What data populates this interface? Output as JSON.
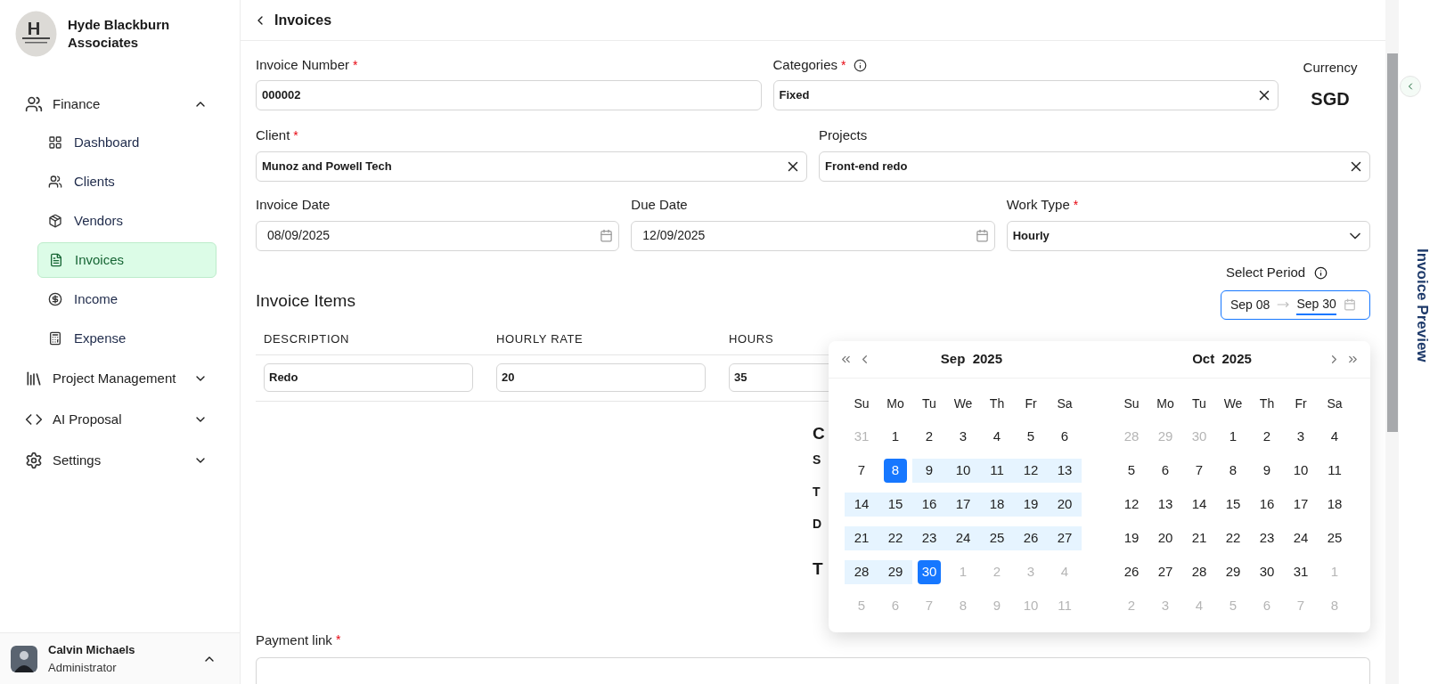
{
  "sidebar": {
    "org_name": "Hyde Blackburn Associates",
    "items": [
      {
        "label": "Finance",
        "expanded": true,
        "children": [
          {
            "label": "Dashboard",
            "selected": false
          },
          {
            "label": "Clients",
            "selected": false
          },
          {
            "label": "Vendors",
            "selected": false
          },
          {
            "label": "Invoices",
            "selected": true
          },
          {
            "label": "Income",
            "selected": false
          },
          {
            "label": "Expense",
            "selected": false
          }
        ]
      },
      {
        "label": "Project Management",
        "expanded": false
      },
      {
        "label": "AI Proposal",
        "expanded": false
      },
      {
        "label": "Settings",
        "expanded": false
      }
    ],
    "user": {
      "name": "Calvin Michaels",
      "role": "Administrator"
    }
  },
  "header": {
    "title": "Invoices"
  },
  "form": {
    "rows": [
      [
        {
          "kind": "text",
          "label": "Invoice Number",
          "required_mark": "*",
          "info": false,
          "value": "000002"
        },
        {
          "kind": "clearable",
          "label": "Categories",
          "required_mark": "*",
          "info": true,
          "value": "Fixed"
        },
        {
          "kind": "readout",
          "label": "Currency",
          "value": "SGD"
        }
      ],
      [
        {
          "kind": "clearable",
          "label": "Client",
          "required_mark": "*",
          "info": false,
          "value": "Munoz and Powell Tech"
        },
        {
          "kind": "clearable",
          "label": "Projects",
          "info": false,
          "value": "Front-end redo"
        }
      ],
      [
        {
          "kind": "date",
          "label": "Invoice Date",
          "info": false,
          "value": "08/09/2025"
        },
        {
          "kind": "date",
          "label": "Due Date",
          "info": false,
          "value": "12/09/2025"
        },
        {
          "kind": "select",
          "label": "Work Type",
          "required_mark": "*",
          "info": false,
          "value": "Hourly"
        }
      ]
    ]
  },
  "period": {
    "label": "Select Period",
    "info": true,
    "start": "Sep 08",
    "end": "Sep 30"
  },
  "invoice_items": {
    "title": "Invoice Items",
    "columns": [
      "DESCRIPTION",
      "HOURLY RATE",
      "HOURS"
    ],
    "rows": [
      [
        "Redo",
        "20",
        "35"
      ]
    ]
  },
  "summary_fragments": [
    {
      "kind": "heading",
      "text": "C"
    },
    {
      "kind": "label",
      "text": "S"
    },
    {
      "kind": "label",
      "text": "T"
    },
    {
      "kind": "label",
      "text": "D"
    },
    {
      "kind": "heading",
      "text": "T"
    }
  ],
  "calendar": {
    "months": [
      {
        "month": "Sep",
        "year": "2025",
        "weekdays": [
          "Su",
          "Mo",
          "Tu",
          "We",
          "Th",
          "Fr",
          "Sa"
        ],
        "weeks": [
          [
            {
              "t": "31",
              "out": true,
              "in_range": false,
              "selected": false
            },
            {
              "t": "1",
              "out": false,
              "in_range": false,
              "selected": false
            },
            {
              "t": "2",
              "out": false,
              "in_range": false,
              "selected": false
            },
            {
              "t": "3",
              "out": false,
              "in_range": false,
              "selected": false
            },
            {
              "t": "4",
              "out": false,
              "in_range": false,
              "selected": false
            },
            {
              "t": "5",
              "out": false,
              "in_range": false,
              "selected": false
            },
            {
              "t": "6",
              "out": false,
              "in_range": false,
              "selected": false
            }
          ],
          [
            {
              "t": "7",
              "out": false,
              "in_range": false,
              "selected": false
            },
            {
              "t": "8",
              "out": false,
              "in_range": false,
              "selected": true
            },
            {
              "t": "9",
              "out": false,
              "in_range": true,
              "selected": false
            },
            {
              "t": "10",
              "out": false,
              "in_range": true,
              "selected": false
            },
            {
              "t": "11",
              "out": false,
              "in_range": true,
              "selected": false
            },
            {
              "t": "12",
              "out": false,
              "in_range": true,
              "selected": false
            },
            {
              "t": "13",
              "out": false,
              "in_range": true,
              "selected": false
            }
          ],
          [
            {
              "t": "14",
              "out": false,
              "in_range": true,
              "selected": false
            },
            {
              "t": "15",
              "out": false,
              "in_range": true,
              "selected": false
            },
            {
              "t": "16",
              "out": false,
              "in_range": true,
              "selected": false
            },
            {
              "t": "17",
              "out": false,
              "in_range": true,
              "selected": false
            },
            {
              "t": "18",
              "out": false,
              "in_range": true,
              "selected": false
            },
            {
              "t": "19",
              "out": false,
              "in_range": true,
              "selected": false
            },
            {
              "t": "20",
              "out": false,
              "in_range": true,
              "selected": false
            }
          ],
          [
            {
              "t": "21",
              "out": false,
              "in_range": true,
              "selected": false
            },
            {
              "t": "22",
              "out": false,
              "in_range": true,
              "selected": false
            },
            {
              "t": "23",
              "out": false,
              "in_range": true,
              "selected": false
            },
            {
              "t": "24",
              "out": false,
              "in_range": true,
              "selected": false
            },
            {
              "t": "25",
              "out": false,
              "in_range": true,
              "selected": false
            },
            {
              "t": "26",
              "out": false,
              "in_range": true,
              "selected": false
            },
            {
              "t": "27",
              "out": false,
              "in_range": true,
              "selected": false
            }
          ],
          [
            {
              "t": "28",
              "out": false,
              "in_range": true,
              "selected": false
            },
            {
              "t": "29",
              "out": false,
              "in_range": true,
              "selected": false
            },
            {
              "t": "30",
              "out": false,
              "in_range": false,
              "selected": true
            },
            {
              "t": "1",
              "out": true,
              "in_range": false,
              "selected": false
            },
            {
              "t": "2",
              "out": true,
              "in_range": false,
              "selected": false
            },
            {
              "t": "3",
              "out": true,
              "in_range": false,
              "selected": false
            },
            {
              "t": "4",
              "out": true,
              "in_range": false,
              "selected": false
            }
          ],
          [
            {
              "t": "5",
              "out": true,
              "in_range": false,
              "selected": false
            },
            {
              "t": "6",
              "out": true,
              "in_range": false,
              "selected": false
            },
            {
              "t": "7",
              "out": true,
              "in_range": false,
              "selected": false
            },
            {
              "t": "8",
              "out": true,
              "in_range": false,
              "selected": false
            },
            {
              "t": "9",
              "out": true,
              "in_range": false,
              "selected": false
            },
            {
              "t": "10",
              "out": true,
              "in_range": false,
              "selected": false
            },
            {
              "t": "11",
              "out": true,
              "in_range": false,
              "selected": false
            }
          ]
        ]
      },
      {
        "month": "Oct",
        "year": "2025",
        "weekdays": [
          "Su",
          "Mo",
          "Tu",
          "We",
          "Th",
          "Fr",
          "Sa"
        ],
        "weeks": [
          [
            {
              "t": "28",
              "out": true,
              "in_range": false,
              "selected": false
            },
            {
              "t": "29",
              "out": true,
              "in_range": false,
              "selected": false
            },
            {
              "t": "30",
              "out": true,
              "in_range": false,
              "selected": false
            },
            {
              "t": "1",
              "out": false,
              "in_range": false,
              "selected": false
            },
            {
              "t": "2",
              "out": false,
              "in_range": false,
              "selected": false
            },
            {
              "t": "3",
              "out": false,
              "in_range": false,
              "selected": false
            },
            {
              "t": "4",
              "out": false,
              "in_range": false,
              "selected": false
            }
          ],
          [
            {
              "t": "5",
              "out": false,
              "in_range": false,
              "selected": false
            },
            {
              "t": "6",
              "out": false,
              "in_range": false,
              "selected": false
            },
            {
              "t": "7",
              "out": false,
              "in_range": false,
              "selected": false
            },
            {
              "t": "8",
              "out": false,
              "in_range": false,
              "selected": false
            },
            {
              "t": "9",
              "out": false,
              "in_range": false,
              "selected": false
            },
            {
              "t": "10",
              "out": false,
              "in_range": false,
              "selected": false
            },
            {
              "t": "11",
              "out": false,
              "in_range": false,
              "selected": false
            }
          ],
          [
            {
              "t": "12",
              "out": false,
              "in_range": false,
              "selected": false
            },
            {
              "t": "13",
              "out": false,
              "in_range": false,
              "selected": false
            },
            {
              "t": "14",
              "out": false,
              "in_range": false,
              "selected": false
            },
            {
              "t": "15",
              "out": false,
              "in_range": false,
              "selected": false
            },
            {
              "t": "16",
              "out": false,
              "in_range": false,
              "selected": false
            },
            {
              "t": "17",
              "out": false,
              "in_range": false,
              "selected": false
            },
            {
              "t": "18",
              "out": false,
              "in_range": false,
              "selected": false
            }
          ],
          [
            {
              "t": "19",
              "out": false,
              "in_range": false,
              "selected": false
            },
            {
              "t": "20",
              "out": false,
              "in_range": false,
              "selected": false
            },
            {
              "t": "21",
              "out": false,
              "in_range": false,
              "selected": false
            },
            {
              "t": "22",
              "out": false,
              "in_range": false,
              "selected": false
            },
            {
              "t": "23",
              "out": false,
              "in_range": false,
              "selected": false
            },
            {
              "t": "24",
              "out": false,
              "in_range": false,
              "selected": false
            },
            {
              "t": "25",
              "out": false,
              "in_range": false,
              "selected": false
            }
          ],
          [
            {
              "t": "26",
              "out": false,
              "in_range": false,
              "selected": false
            },
            {
              "t": "27",
              "out": false,
              "in_range": false,
              "selected": false
            },
            {
              "t": "28",
              "out": false,
              "in_range": false,
              "selected": false
            },
            {
              "t": "29",
              "out": false,
              "in_range": false,
              "selected": false
            },
            {
              "t": "30",
              "out": false,
              "in_range": false,
              "selected": false
            },
            {
              "t": "31",
              "out": false,
              "in_range": false,
              "selected": false
            },
            {
              "t": "1",
              "out": true,
              "in_range": false,
              "selected": false
            }
          ],
          [
            {
              "t": "2",
              "out": true,
              "in_range": false,
              "selected": false
            },
            {
              "t": "3",
              "out": true,
              "in_range": false,
              "selected": false
            },
            {
              "t": "4",
              "out": true,
              "in_range": false,
              "selected": false
            },
            {
              "t": "5",
              "out": true,
              "in_range": false,
              "selected": false
            },
            {
              "t": "6",
              "out": true,
              "in_range": false,
              "selected": false
            },
            {
              "t": "7",
              "out": true,
              "in_range": false,
              "selected": false
            },
            {
              "t": "8",
              "out": true,
              "in_range": false,
              "selected": false
            }
          ]
        ]
      }
    ]
  },
  "payment": {
    "label": "Payment link",
    "required_mark": "*"
  },
  "preview_panel": {
    "title": "Invoice Preview"
  }
}
